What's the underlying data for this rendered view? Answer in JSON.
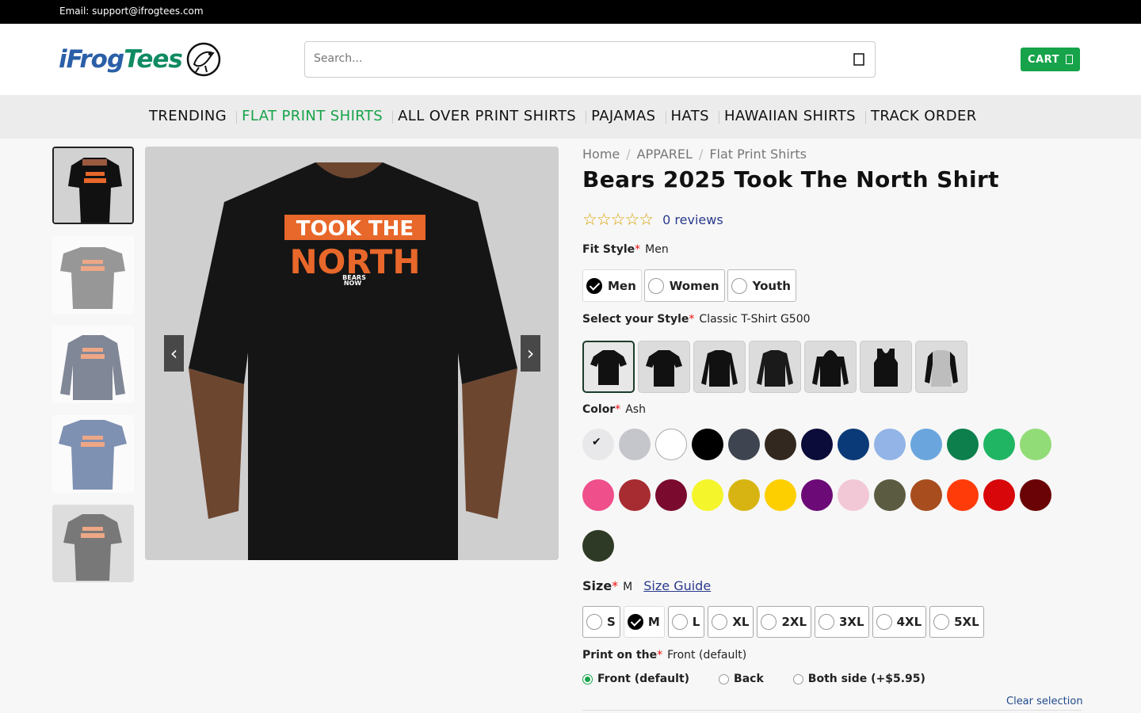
{
  "topbar": {
    "email": "Email: support@ifrogtees.com"
  },
  "logo": {
    "part1": "iFrog",
    "part2": "Tees"
  },
  "search": {
    "placeholder": "Search..."
  },
  "cart": {
    "label": "CART"
  },
  "nav": {
    "items": [
      "TRENDING",
      "FLAT PRINT SHIRTS",
      "ALL OVER PRINT SHIRTS",
      "PAJAMAS",
      "HATS",
      "HAWAIIAN SHIRTS",
      "TRACK ORDER"
    ],
    "active_index": 1
  },
  "breadcrumbs": [
    "Home",
    "APPAREL",
    "Flat Print Shirts"
  ],
  "product": {
    "title": "Bears 2025 Took The North Shirt",
    "shirt_line1": "TOOK THE",
    "shirt_line2": "NORTH",
    "shirt_tag1": "BEARS",
    "shirt_tag2": "NOW"
  },
  "rating": {
    "stars": "☆☆☆☆☆",
    "reviews": "0 reviews"
  },
  "fit": {
    "label": "Fit Style",
    "value": "Men",
    "options": [
      "Men",
      "Women",
      "Youth"
    ]
  },
  "style": {
    "label": "Select your Style",
    "value": "Classic T-Shirt G500"
  },
  "color": {
    "label": "Color",
    "value": "Ash",
    "swatches": [
      "#e8e8ea",
      "#c4c6cb",
      "#ffffff",
      "#000000",
      "#3f4550",
      "#33281f",
      "#0b0c3a",
      "#0a3a78",
      "#92b4e6",
      "#6aa6dd",
      "#0c7f4c",
      "#1fb563",
      "#92dc78",
      "#ef4f8b",
      "#a72c31",
      "#7a0a2e",
      "#f4f52a",
      "#d8b412",
      "#fdcf00",
      "#6c0a78",
      "#f2c8d6",
      "#5b5b41",
      "#a74d1e",
      "#ff3b0a",
      "#d8070a",
      "#6a0305",
      "#2e3a25"
    ]
  },
  "size": {
    "label": "Size",
    "value": "M",
    "guide": "Size Guide",
    "options": [
      "S",
      "M",
      "L",
      "XL",
      "2XL",
      "3XL",
      "4XL",
      "5XL"
    ]
  },
  "print": {
    "label": "Print on the",
    "value": "Front (default)",
    "options": [
      "Front (default)",
      "Back",
      "Both side (+$5.95)"
    ]
  },
  "clear": "Clear selection",
  "colors_ui": {
    "accent": "#16a34a",
    "required": "#e11111",
    "link": "#2a3a8c"
  }
}
